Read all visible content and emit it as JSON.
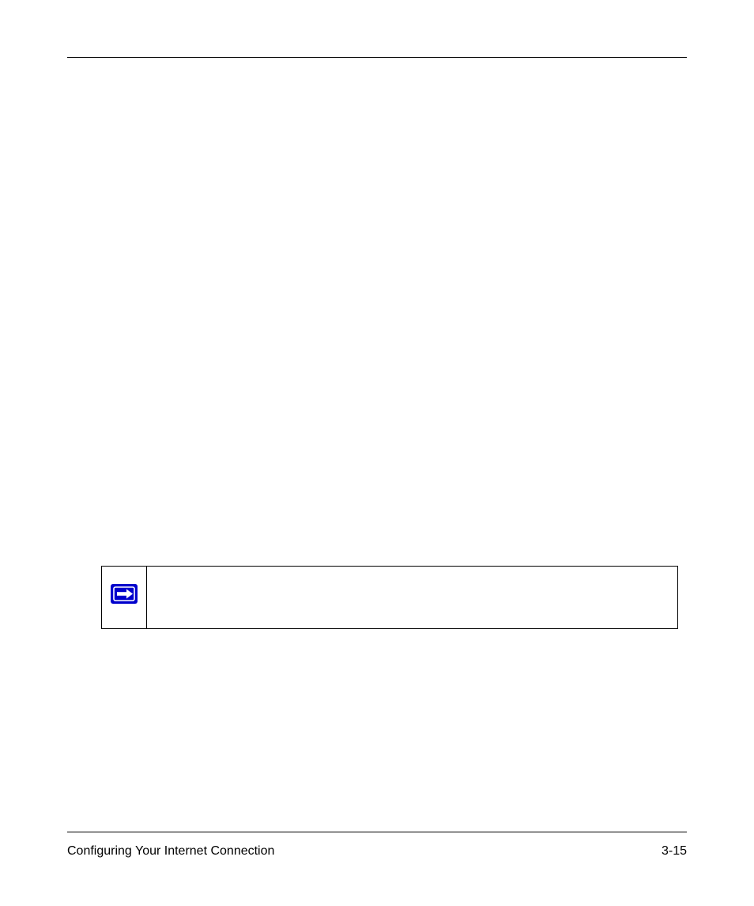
{
  "footer": {
    "left": "Configuring Your Internet Connection",
    "right": "3-15"
  },
  "note": {
    "icon_name": "arrow-right-icon"
  }
}
